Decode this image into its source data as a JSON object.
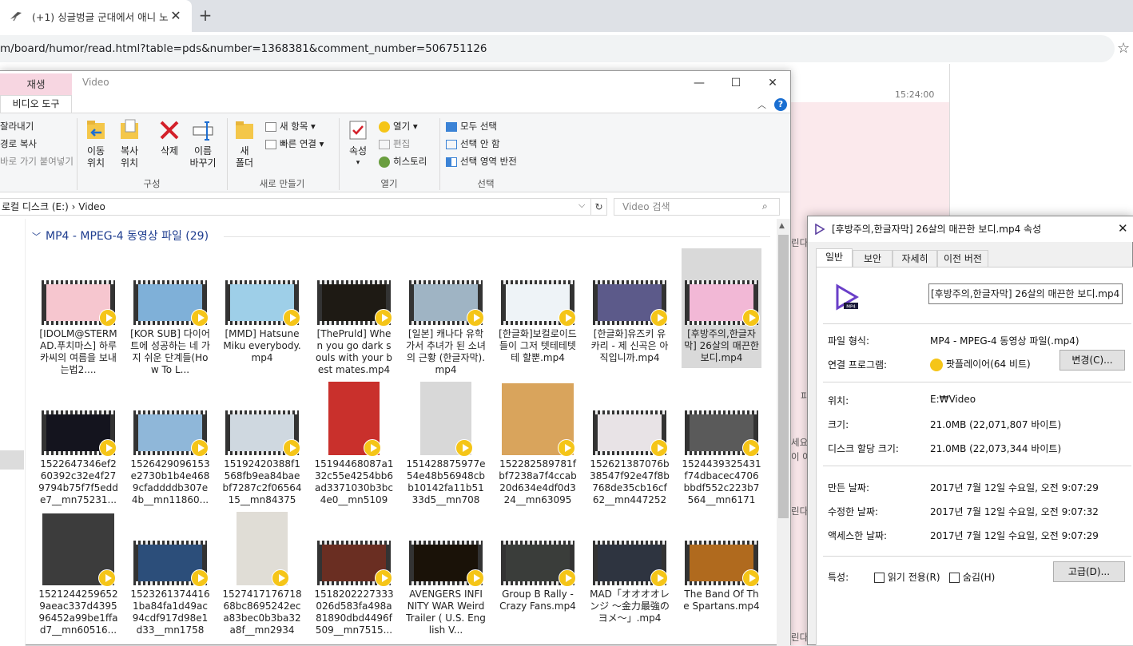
{
  "browser": {
    "tab_title": "(+1) 싱글벙글 군대에서 애니 노",
    "url": "m/board/humor/read.html?table=pds&number=1368381&comment_number=506751126",
    "star_icon": "star-icon",
    "page_time": "15:24:00",
    "page_fragments": [
      "린다",
      "피",
      "세요",
      "이 아",
      "린다",
      "린다"
    ]
  },
  "explorer": {
    "context_tab": "재생",
    "title": "Video",
    "ribbon_tab": "비디오 도구",
    "clipboard": [
      "잘라내기",
      "경로 복사",
      "바로 가기 붙여넣기"
    ],
    "organize": {
      "move": "이동\n위치",
      "copy": "복사\n위치",
      "delete": "삭제",
      "rename": "이름\n바꾸기",
      "label": "구성"
    },
    "new": {
      "new_folder": "새\n폴더",
      "new_item": "새 항목",
      "easy_access": "빠른 연결",
      "label": "새로 만들기"
    },
    "open": {
      "properties": "속성",
      "open": "열기",
      "edit": "편집",
      "history": "히스토리",
      "label": "열기"
    },
    "select": {
      "select_all": "모두 선택",
      "select_none": "선택 안 함",
      "invert": "선택 영역 반전",
      "label": "선택"
    },
    "breadcrumb": "로컬 디스크 (E:)  ›  Video",
    "search_placeholder": "Video 검색",
    "group_header": "MP4 - MPEG-4 동영상 파일 (29)",
    "files": [
      {
        "name": "[IDOLM@STERMAD.푸치마스] 하루카씨의 여름을 보내는법2....",
        "thumb": "#f6c6cf"
      },
      {
        "name": "[KOR SUB] 다이어트에 성공하는 네 가지 쉬운 단계들(How To L...",
        "thumb": "#7fb0d8"
      },
      {
        "name": "[MMD] Hatsune Miku everybody.mp4",
        "thumb": "#9ecfe8"
      },
      {
        "name": "[ThePruld] When you go dark souls with your best mates.mp4",
        "thumb": "#1e1a14"
      },
      {
        "name": "[일본] 캐나다 유학가서 추녀가 된 소녀의 근황 (한글자막).mp4",
        "thumb": "#9fb4c4"
      },
      {
        "name": "[한글화]보컬로이드들이 그저 텟테테텟테 할뿐.mp4",
        "thumb": "#eef3f7"
      },
      {
        "name": "[한글화]유즈키 유카리 - 제 신곡은 아직입니까.mp4",
        "thumb": "#5c5a8a"
      },
      {
        "name": "[후방주의,한글자막] 26살의 매끈한 보디.mp4",
        "thumb": "#f2b8d6",
        "selected": true
      },
      {
        "name": "1522647346ef260392c32e4f279794b75f7f5edde7__mn75231...",
        "thumb": "#14141e"
      },
      {
        "name": "1526429096153e2730b1b4e4689cfaddddb307e4b__mn11860...",
        "thumb": "#8fb7d9"
      },
      {
        "name": "15192420388f1568fb9ea84baebf7287c2f0656415__mn84375_...",
        "thumb": "#cfd8e0"
      },
      {
        "name": "15194468087a132c55e4254bb6ad3371030b3bc4e0__mn51092...",
        "thumb": "#c9302c",
        "portrait": true
      },
      {
        "name": "151428875977e54e48b56948cbb10142fa11b5133d5__mn7087...",
        "thumb": "#d8d8d8",
        "portrait": true
      },
      {
        "name": "152282589781fbf7238a7f4ccab20d634e4df0d324__mn63095_...",
        "thumb": "#d9a45c",
        "square": true
      },
      {
        "name": "152621387076b38547f92e47f8b768de35cb16cf62__mn447252_...",
        "thumb": "#e8e3e6"
      },
      {
        "name": "1524439325431f74dbacec4706bbdf552c223b7564__mn61710...",
        "thumb": "#5a5a5a"
      },
      {
        "name": "15212442596529aeac337d439596452a99be1ffad7__mn60516...",
        "thumb": "#3c3c3c",
        "square": true
      },
      {
        "name": "15232613744161ba84fa1d49ac94cdf917d98e1d33__mn17587...",
        "thumb": "#2c4e7a"
      },
      {
        "name": "152741717671868bc8695242eca83bec0b3ba32a8f__mn29346...",
        "thumb": "#e0ddd6",
        "portrait": true
      },
      {
        "name": "1518202227333026d583fa498a81890dbd4496f509__mn7515...",
        "thumb": "#6a2e22"
      },
      {
        "name": "AVENGERS INFINITY WAR Weird Trailer ( U.S. English V...",
        "thumb": "#1a1208"
      },
      {
        "name": "Group B Rally - Crazy Fans.mp4",
        "thumb": "#3a3d3a"
      },
      {
        "name": "MAD「オオオオレンジ ～金力最強のヨメ～」.mp4",
        "thumb": "#2e3440"
      },
      {
        "name": "The Band Of The Spartans.mp4",
        "thumb": "#b06a1e"
      }
    ]
  },
  "properties": {
    "title": "[후방주의,한글자막] 26살의 매끈한 보디.mp4 속성",
    "tabs": [
      "일반",
      "보안",
      "자세히",
      "이전 버전"
    ],
    "filename": "[후방주의,한글자막] 26살의 매끈한 보디.mp4",
    "rows": {
      "type_label": "파일 형식:",
      "type_value": "MP4 - MPEG-4 동영상 파일(.mp4)",
      "opens_label": "연결 프로그램:",
      "opens_value": "팟플레이어(64 비트)",
      "change_button": "변경(C)...",
      "location_label": "위치:",
      "location_value": "E:₩Video",
      "size_label": "크기:",
      "size_value": "21.0MB (22,071,807 바이트)",
      "disk_label": "디스크 할당 크기:",
      "disk_value": "21.0MB (22,073,344 바이트)",
      "created_label": "만든 날짜:",
      "created_value": "2017년 7월 12일 수요일, 오전 9:07:29",
      "modified_label": "수정한 날짜:",
      "modified_value": "2017년 7월 12일 수요일, 오전 9:07:32",
      "accessed_label": "액세스한 날짜:",
      "accessed_value": "2017년 7월 12일 수요일, 오전 9:07:29",
      "attr_label": "특성:",
      "readonly_label": "읽기 전용(R)",
      "hidden_label": "숨김(H)",
      "advanced_button": "고급(D)..."
    }
  }
}
